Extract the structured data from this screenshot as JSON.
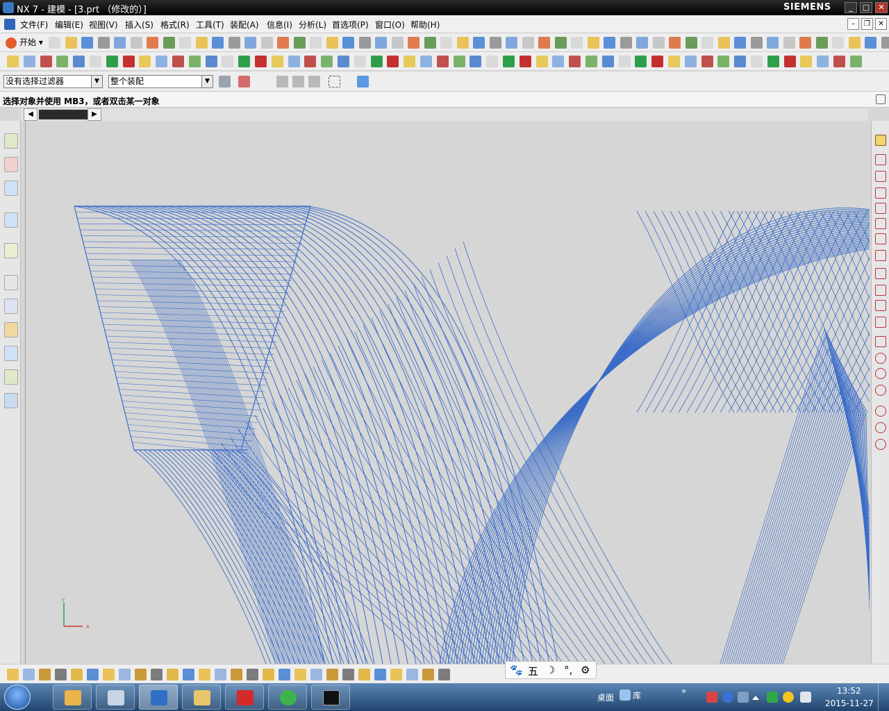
{
  "window": {
    "title": "NX 7 - 建模 - [3.prt （修改的）]",
    "brand": "SIEMENS",
    "minimize": "_",
    "maximize": "□",
    "close": "✕"
  },
  "menu": {
    "items": [
      "文件(F)",
      "编辑(E)",
      "视图(V)",
      "插入(S)",
      "格式(R)",
      "工具(T)",
      "装配(A)",
      "信息(I)",
      "分析(L)",
      "首选项(P)",
      "窗口(O)",
      "帮助(H)"
    ],
    "mdi_minimize": "–",
    "mdi_restore": "❐",
    "mdi_close": "✕"
  },
  "toolbar": {
    "start_label": "开始",
    "start_arrow": "▾"
  },
  "selection": {
    "filter_value": "没有选择过滤器",
    "scope_value": "整个装配",
    "arrow": "▼"
  },
  "status": {
    "message": "选择对象并使用 MB3，或者双击某一对象"
  },
  "tabs": {
    "left_arrow": "◀",
    "right_arrow": "▶"
  },
  "viewport": {
    "wire_color": "#3a6cc8",
    "background": "#d6d6d6",
    "triad": {
      "y_label": "Y",
      "x_label": "X",
      "y_color": "#2ea043",
      "x_color": "#d03030"
    }
  },
  "ime": {
    "items": [
      "🐾",
      "五",
      "☽",
      "°,",
      "⚙"
    ]
  },
  "taskbar": {
    "desktop_label": "桌面",
    "library_label": "库",
    "expand": "»",
    "time": "13:52",
    "date": "2015-11-27"
  }
}
